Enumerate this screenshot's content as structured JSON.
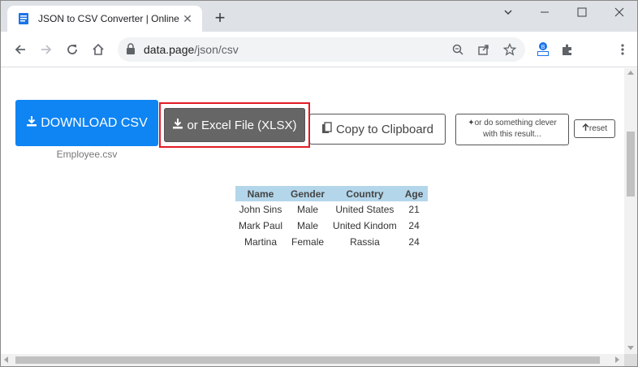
{
  "browser": {
    "tab_title": "JSON to CSV Converter | Online T",
    "url_domain": "data.page",
    "url_path": "/json/csv"
  },
  "icons": {
    "favicon": "document-icon",
    "tab_close": "close-icon",
    "new_tab": "plus-icon",
    "minimize": "minimize-icon",
    "maximize": "maximize-icon",
    "close_window": "close-icon",
    "back": "back-arrow-icon",
    "forward": "forward-arrow-icon",
    "reload": "reload-icon",
    "home": "home-icon",
    "lock": "lock-icon",
    "zoom": "zoom-icon",
    "share": "share-icon",
    "bookmark": "star-icon",
    "extension": "extension-icon",
    "puzzle": "puzzle-icon",
    "menu": "kebab-menu-icon"
  },
  "colors": {
    "download_button": "#0f84f3",
    "excel_button": "#666666",
    "highlight_border": "#e11c24",
    "table_header": "#b3d6ea"
  },
  "actions": {
    "download_label": "DOWNLOAD CSV",
    "download_filename": "Employee.csv",
    "excel_label": "or Excel File (XLSX)",
    "copy_label": "Copy to Clipboard",
    "clever_label_line1": "or do something clever",
    "clever_label_line2": "with this result...",
    "reset_label": "reset"
  },
  "table": {
    "headers": [
      "Name",
      "Gender",
      "Country",
      "Age"
    ],
    "rows": [
      [
        "John Sins",
        "Male",
        "United States",
        "21"
      ],
      [
        "Mark Paul",
        "Male",
        "United Kindom",
        "24"
      ],
      [
        "Martina",
        "Female",
        "Rassia",
        "24"
      ]
    ]
  }
}
